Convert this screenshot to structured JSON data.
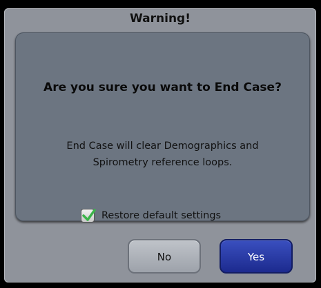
{
  "dialog": {
    "title": "Warning!",
    "question": "Are you sure you want to End Case?",
    "message_line1": "End Case will clear Demographics and",
    "message_line2": "Spirometry reference loops.",
    "checkbox": {
      "label": "Restore default settings",
      "checked": true,
      "icon": "check-icon"
    },
    "buttons": {
      "no_label": "No",
      "yes_label": "Yes"
    }
  },
  "colors": {
    "dialog_bg": "#8f939b",
    "panel_bg": "#6c7581",
    "yes_button": "#26369f",
    "checkmark": "#3bb44a"
  }
}
